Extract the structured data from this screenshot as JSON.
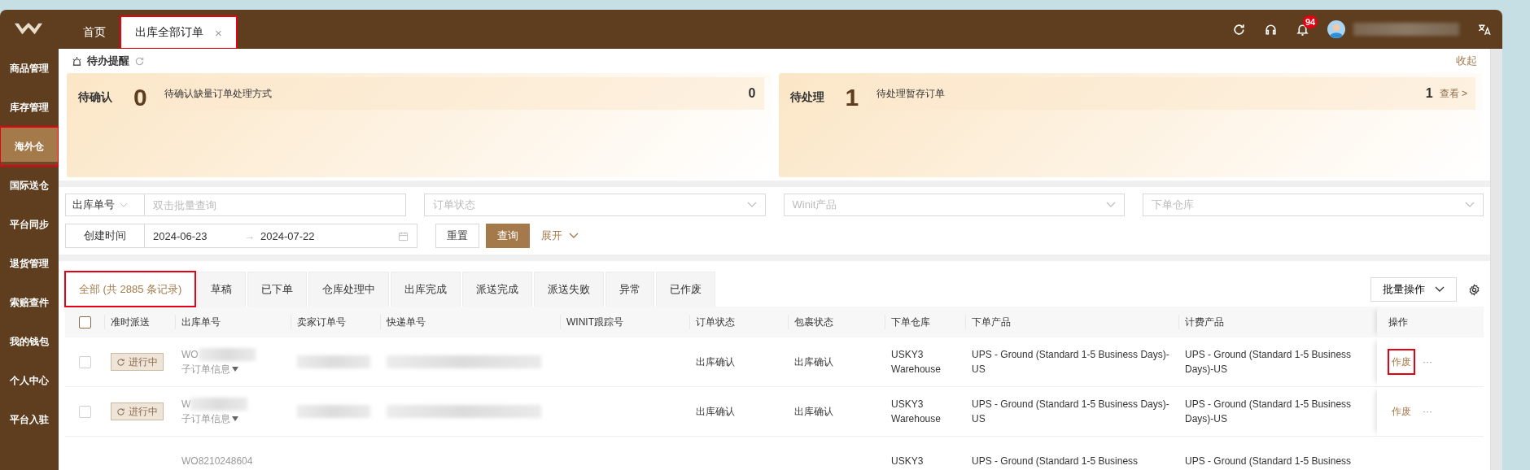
{
  "topbar": {
    "tabs": [
      {
        "label": "首页",
        "selected": false
      },
      {
        "label": "出库全部订单",
        "selected": true,
        "close": "×",
        "annotated": true
      }
    ],
    "notification_count": "94"
  },
  "sidebar": {
    "items": [
      {
        "label": "商品管理",
        "selected": false
      },
      {
        "label": "库存管理",
        "selected": false
      },
      {
        "label": "海外仓",
        "selected": true,
        "annotated": true
      },
      {
        "label": "国际送仓",
        "selected": false
      },
      {
        "label": "平台同步",
        "selected": false
      },
      {
        "label": "退货管理",
        "selected": false
      },
      {
        "label": "索赔查件",
        "selected": false
      },
      {
        "label": "我的钱包",
        "selected": false
      },
      {
        "label": "个人中心",
        "selected": false
      },
      {
        "label": "平台入驻",
        "selected": false
      }
    ]
  },
  "reminder": {
    "title": "待办提醒",
    "collapse": "收起",
    "cards": [
      {
        "label": "待确认",
        "count": "0",
        "description": "待确认缺量订单处理方式",
        "total": "0"
      },
      {
        "label": "待处理",
        "count": "1",
        "description": "待处理暂存订单",
        "total": "1",
        "link": "查看 >"
      }
    ]
  },
  "filters": {
    "row": [
      {
        "kind": "select-input",
        "select": "出库单号",
        "placeholder": "双击批量查询"
      },
      {
        "kind": "select",
        "placeholder": "订单状态"
      },
      {
        "kind": "select",
        "placeholder": "Winit产品"
      },
      {
        "kind": "select",
        "placeholder": "下单仓库"
      }
    ],
    "date": {
      "label": "创建时间",
      "start": "2024-06-23",
      "separator": "→",
      "end": "2024-07-22"
    },
    "reset": "重置",
    "search": "查询",
    "expand": "展开"
  },
  "status_tabs": [
    {
      "label": "全部 (共 2885 条记录)",
      "selected": true,
      "annotated": true
    },
    {
      "label": "草稿",
      "selected": false
    },
    {
      "label": "已下单",
      "selected": false
    },
    {
      "label": "仓库处理中",
      "selected": false
    },
    {
      "label": "出库完成",
      "selected": false
    },
    {
      "label": "派送完成",
      "selected": false
    },
    {
      "label": "派送失败",
      "selected": false
    },
    {
      "label": "异常",
      "selected": false
    },
    {
      "label": "已作废",
      "selected": false
    }
  ],
  "batch_button": "批量操作",
  "table": {
    "header_checked": false,
    "columns": [
      "准时派送",
      "出库单号",
      "卖家订单号",
      "快递单号",
      "WINIT跟踪号",
      "订单状态",
      "包裹状态",
      "下单仓库",
      "下单产品",
      "计费产品",
      "操作"
    ],
    "rows": [
      {
        "checked": false,
        "ontime": "进行中",
        "order_no": "WO",
        "sub_info": "子订单信息",
        "order_status": "出库确认",
        "package_status": "出库确认",
        "warehouse": "USKY3 Warehouse",
        "product": "UPS - Ground (Standard 1-5 Business Days)-US",
        "billing": "UPS - Ground (Standard 1-5 Business Days)-US",
        "action": "作废",
        "more": "···",
        "annotated": true
      },
      {
        "checked": false,
        "ontime": "进行中",
        "order_no": "W",
        "sub_info": "子订单信息",
        "order_status": "出库确认",
        "package_status": "出库确认",
        "warehouse": "USKY3 Warehouse",
        "product": "UPS - Ground (Standard 1-5 Business Days)-US",
        "billing": "UPS - Ground (Standard 1-5 Business Days)-US",
        "action": "作废",
        "more": "···"
      },
      {
        "order_no": "WO8210248604",
        "warehouse": "USKY3",
        "product": "UPS - Ground (Standard 1-5 Business",
        "billing": "UPS - Ground (Standard 1-5 Business"
      }
    ]
  }
}
